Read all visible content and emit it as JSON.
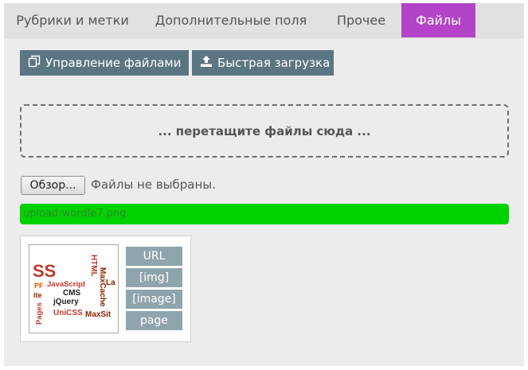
{
  "tabs": [
    {
      "label": "Рубрики и метки"
    },
    {
      "label": "Дополнительные поля"
    },
    {
      "label": "Прочее"
    },
    {
      "label": "Файлы"
    }
  ],
  "toolbar": {
    "manage_label": "Управление файлами",
    "manage_icon": "files-copy-icon",
    "upload_label": "Быстрая загрузка",
    "upload_icon": "upload-icon"
  },
  "dropzone": {
    "text": "... перетащите файлы сюда ..."
  },
  "file_input": {
    "button_label": "Обзор...",
    "status": "Файлы не выбраны."
  },
  "upload": {
    "label": "upload:wordle7.png",
    "progress": 1.0
  },
  "file_card": {
    "thumbnail_words": [
      "SS",
      "HTML",
      "La",
      "JavaScript",
      "MaxCache",
      "PF",
      "CMS",
      "ite",
      "jQuery",
      "Pages",
      "UniCSS",
      "MaxSit"
    ],
    "actions": [
      "URL",
      "[img]",
      "[image]",
      "page"
    ]
  },
  "colors": {
    "active_tab": "#b344c8",
    "toolbar_button": "#5b7582",
    "progress_fill": "#00d200",
    "action_button": "#90a4ae"
  }
}
